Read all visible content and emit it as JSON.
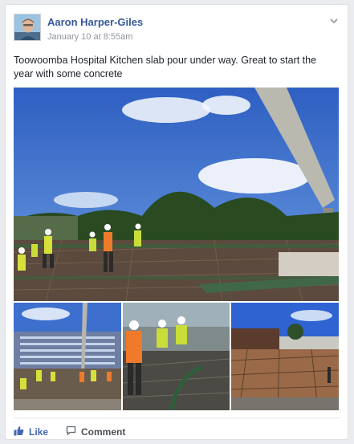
{
  "post": {
    "author": "Aaron Harper-Giles",
    "timestamp": "January 10 at 8:55am",
    "text": "Toowoomba Hospital Kitchen slab pour under way. Great to start the year with some concrete"
  },
  "actions": {
    "like_label": "Like",
    "comment_label": "Comment"
  },
  "icons": {
    "options": "chevron-down-icon",
    "like": "thumbs-up-icon",
    "comment": "speech-bubble-icon"
  },
  "colors": {
    "author_link": "#365899",
    "like_accent": "#4267b2",
    "meta_text": "#90949c",
    "background": "#e9ebee"
  }
}
